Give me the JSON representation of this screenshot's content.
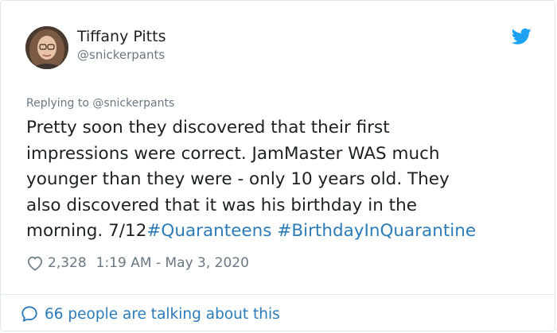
{
  "author": {
    "display_name": "Tiffany Pitts",
    "handle": "@snickerpants"
  },
  "icons": {
    "brand": "twitter-bird-icon",
    "like": "heart-icon",
    "conversation": "speech-bubble-icon"
  },
  "colors": {
    "brand_blue": "#1da1f2",
    "link_blue": "#2b7bb9",
    "muted_gray": "#697882",
    "text": "#1c2022"
  },
  "reply": {
    "label": "Replying to @snickerpants"
  },
  "tweet": {
    "line1": "Pretty soon they discovered that their first",
    "line2": "impressions were correct. JamMaster WAS much",
    "line3": "younger than they were - only 10 years old. They",
    "line4": "also discovered that it was his birthday in the",
    "line5_text": "morning. 7/12",
    "hashtag1": "#Quaranteens",
    "hashtag2": "#BirthdayInQuarantine"
  },
  "meta": {
    "likes": "2,328",
    "timestamp": "1:19 AM - May 3, 2020"
  },
  "footer": {
    "talking": "66 people are talking about this"
  }
}
